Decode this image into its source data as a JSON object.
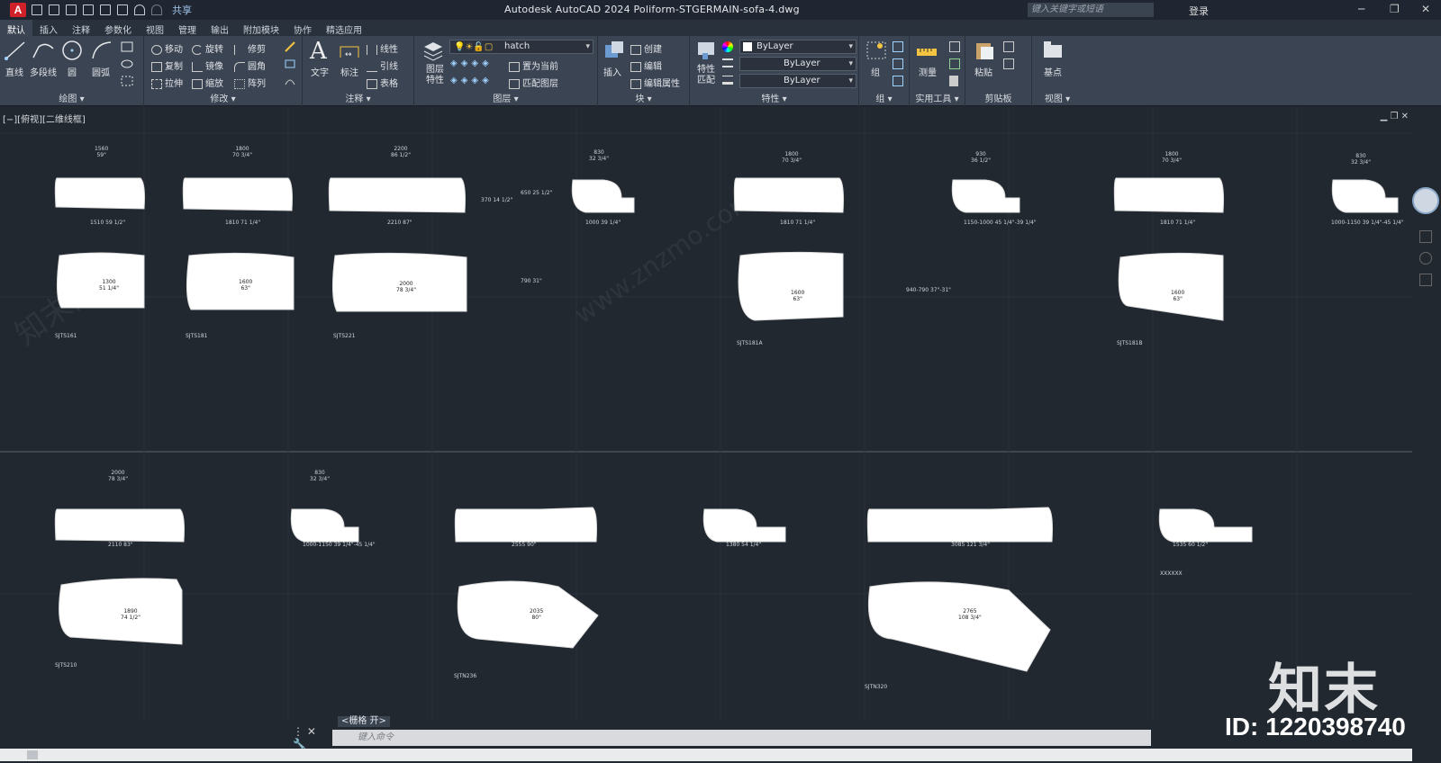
{
  "window": {
    "title": "Autodesk AutoCAD 2024    Poliform-STGERMAIN-sofa-4.dwg",
    "search_placeholder": "键入关键字或短语",
    "login_label": "登录",
    "share_label": "共享",
    "app_letter": "A"
  },
  "tabs": [
    "默认",
    "插入",
    "注释",
    "参数化",
    "视图",
    "管理",
    "输出",
    "附加模块",
    "协作",
    "精选应用"
  ],
  "ribbon": {
    "draw": {
      "label": "绘图 ▾",
      "tools": [
        "直线",
        "多段线",
        "圆",
        "圆弧"
      ]
    },
    "modify": {
      "label": "修改 ▾",
      "tools": [
        "移动",
        "旋转",
        "修剪",
        "复制",
        "镜像",
        "圆角",
        "拉伸",
        "缩放",
        "阵列"
      ]
    },
    "annotation": {
      "label": "注释 ▾",
      "tools": [
        "文字",
        "标注",
        "线性",
        "引线",
        "表格"
      ]
    },
    "layers": {
      "label": "图层 ▾",
      "layer_props": "图层\n特性",
      "current_layer": "hatch",
      "set_current": "置为当前",
      "match_layer": "匹配图层"
    },
    "block": {
      "label": "块 ▾",
      "insert": "插入",
      "create": "创建",
      "edit": "编辑",
      "edit_attr": "编辑属性"
    },
    "properties": {
      "label": "特性 ▾",
      "match": "特性\n匹配",
      "color": "ByLayer",
      "linetype": "ByLayer",
      "lineweight": "ByLayer"
    },
    "groups": {
      "label": "组 ▾",
      "group": "组"
    },
    "utilities": {
      "label": "实用工具 ▾",
      "measure": "测量"
    },
    "clipboard": {
      "label": "剪贴板",
      "paste": "粘贴"
    },
    "view": {
      "label": "视图 ▾",
      "base": "基点"
    }
  },
  "viewport": {
    "label": "[−][俯视][二维线框]"
  },
  "drawing": {
    "top_dims": [
      {
        "a": "1560",
        "b": "59\""
      },
      {
        "a": "1800",
        "b": "70 3/4\""
      },
      {
        "a": "2200",
        "b": "86 1/2\""
      },
      {
        "a": "830",
        "b": "32 3/4\""
      },
      {
        "a": "1800",
        "b": "70 3/4\""
      },
      {
        "a": "930",
        "b": "36 1/2\""
      },
      {
        "a": "1800",
        "b": "70 3/4\""
      },
      {
        "a": "830",
        "b": "32 3/4\""
      }
    ],
    "seat_labels": [
      {
        "a": "1300",
        "b": "51 1/4\""
      },
      {
        "a": "1600",
        "b": "63\""
      },
      {
        "a": "2000",
        "b": "78 3/4\""
      },
      {
        "a": "1600",
        "b": "63\""
      },
      {
        "a": "1600",
        "b": "63\""
      },
      {
        "a": "1890",
        "b": "74 1/2\""
      },
      {
        "a": "2035",
        "b": "80\""
      },
      {
        "a": "2765",
        "b": "108 3/4\""
      }
    ],
    "model_codes": [
      "SJTS161",
      "SJTS181",
      "SJTS221",
      "SJTS181A",
      "SJTS181B",
      "SJTS210",
      "SJTN236",
      "SJTN320"
    ],
    "bottom_dims": [
      {
        "a": "2000",
        "b": "78 3/4\""
      },
      {
        "a": "830",
        "b": "32 3/4\""
      }
    ],
    "width_dims": [
      "1510  59 1/2\"",
      "1810  71 1/4\"",
      "2210  87\"",
      "1810  71 1/4\"",
      "1810  71 1/4\"",
      "2110  83\"",
      "2555  90\"",
      "3085  121 3/4\""
    ],
    "depth_dims": [
      "1000  39 1/4\"",
      "1150-1000  45 1/4\"-39 1/4\"",
      "1000-1150  39 1/4\"-45 1/4\"",
      "1000-1150  39 1/4\"-45 1/4\"",
      "1380  54 1/4\"",
      "1535  60 1/2\""
    ],
    "height_dims": [
      "370  14 1/2\"",
      "650  25 1/2\"",
      "790  31\"",
      "940-790  37\"-31\""
    ],
    "nx_code": "XXXXXX"
  },
  "watermark": {
    "logo": "知末",
    "id": "ID: 1220398740",
    "site": "www.znzmo.com",
    "cn": "知末网"
  },
  "status": {
    "grid_tip": "<栅格 开>",
    "command_placeholder": "键入命令"
  },
  "colors": {
    "ribbon": "#3b4453",
    "canvas": "#212830",
    "title": "#1f2631",
    "autocad_red": "#d0202a"
  }
}
